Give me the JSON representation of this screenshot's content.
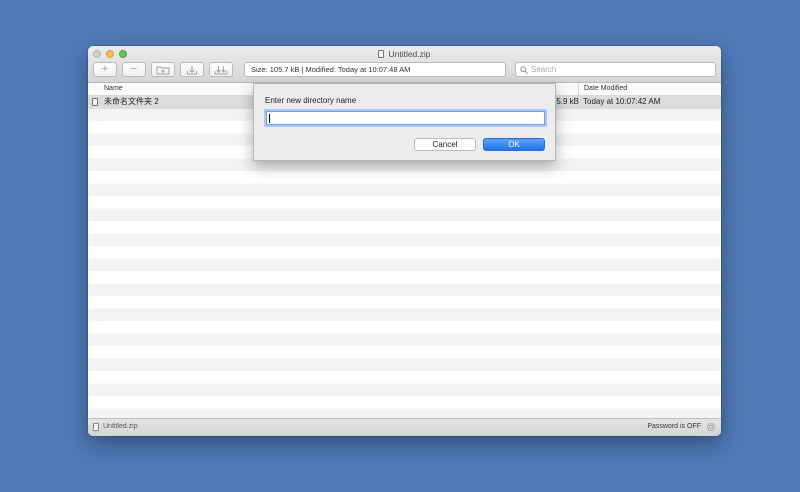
{
  "window": {
    "title": "Untitled.zip"
  },
  "toolbar": {
    "add_label": "+",
    "remove_label": "−",
    "info_text": "Size: 105.7 kB  |  Modified: Today at 10:07:48 AM",
    "search_placeholder": "Search"
  },
  "columns": {
    "name": "Name",
    "date_modified": "Date Modified"
  },
  "files": [
    {
      "name": "未命名文件夹 2",
      "size": "5.9 kB",
      "date": "Today at 10:07:42 AM"
    }
  ],
  "statusbar": {
    "file": "Untitled.zip",
    "password_status": "Password is OFF"
  },
  "dialog": {
    "prompt": "Enter new directory name",
    "input_value": "",
    "cancel_label": "Cancel",
    "ok_label": "OK"
  },
  "colors": {
    "desktop": "#4f7ab8",
    "accent": "#1f71ef"
  }
}
